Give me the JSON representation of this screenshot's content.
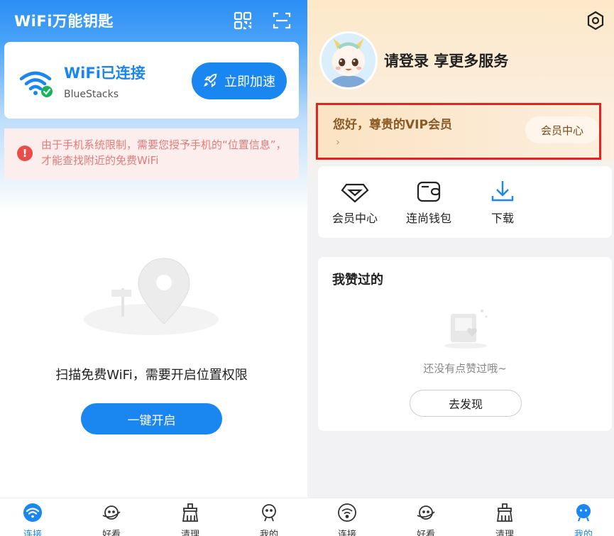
{
  "left": {
    "app_title": "WiFi万能钥匙",
    "connection": {
      "status": "WiFi已连接",
      "network": "BlueStacks",
      "boost_label": "立即加速"
    },
    "warning": "由于手机系统限制，需要您授予手机的“位置信息”，才能查找附近的免费WiFi",
    "scan_text": "扫描免费WiFi，需要开启位置权限",
    "open_button": "一键开启",
    "tabs": [
      {
        "label": "连接",
        "icon": "wifi-icon",
        "active": true
      },
      {
        "label": "好看",
        "icon": "planet-icon",
        "active": false
      },
      {
        "label": "清理",
        "icon": "broom-icon",
        "active": false
      },
      {
        "label": "我的",
        "icon": "profile-icon",
        "active": false
      }
    ]
  },
  "right": {
    "login_text": "请登录 享更多服务",
    "vip": {
      "title": "您好，尊贵的VIP会员",
      "chevron": "›",
      "button": "会员中心"
    },
    "quick_actions": [
      {
        "label": "会员中心",
        "icon": "diamond-icon"
      },
      {
        "label": "连尚钱包",
        "icon": "wallet-icon"
      },
      {
        "label": "下载",
        "icon": "download-icon"
      }
    ],
    "liked": {
      "title": "我赞过的",
      "empty_text": "还没有点赞过哦~",
      "discover_button": "去发现"
    },
    "tabs": [
      {
        "label": "连接",
        "icon": "wifi-icon",
        "active": false
      },
      {
        "label": "好看",
        "icon": "planet-icon",
        "active": false
      },
      {
        "label": "清理",
        "icon": "broom-icon",
        "active": false
      },
      {
        "label": "我的",
        "icon": "profile-icon",
        "active": true
      }
    ]
  },
  "colors": {
    "brand_blue": "#1a86f0",
    "warning_red": "#e94d4a",
    "vip_brown": "#8a5a24",
    "highlight_red": "#e8211f"
  }
}
